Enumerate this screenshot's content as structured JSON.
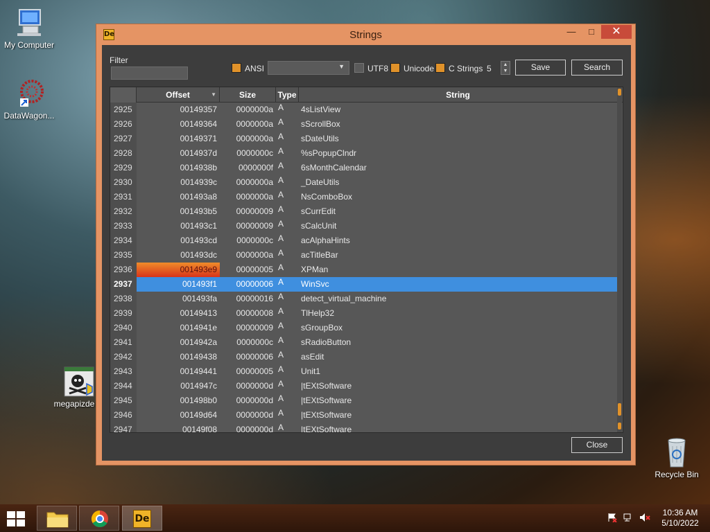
{
  "desktop": {
    "icons": [
      {
        "label": "My Computer"
      },
      {
        "label": "DataWagon..."
      },
      {
        "label": "megapizde"
      },
      {
        "label": "Recycle Bin"
      }
    ]
  },
  "window": {
    "title": "Strings",
    "minimize": "—",
    "maximize": "□",
    "close": "✕",
    "app_icon_text": "De"
  },
  "filter": {
    "label": "Filter",
    "value": ""
  },
  "options": {
    "ansi_label": "ANSI",
    "ansi_checked": true,
    "encoding_selected": "",
    "utf8_label": "UTF8",
    "utf8_checked": false,
    "unicode_label": "Unicode",
    "unicode_checked": true,
    "cstrings_label": "C Strings",
    "cstrings_checked": true,
    "min_length": "5"
  },
  "buttons": {
    "save": "Save",
    "search": "Search",
    "close": "Close"
  },
  "table": {
    "columns": {
      "offset": "Offset",
      "size": "Size",
      "type": "Type",
      "string": "String"
    },
    "rows": [
      {
        "idx": "2925",
        "offset": "00149357",
        "size": "0000000a",
        "type": "A",
        "string": "4sListView"
      },
      {
        "idx": "2926",
        "offset": "00149364",
        "size": "0000000a",
        "type": "A",
        "string": "sScrollBox"
      },
      {
        "idx": "2927",
        "offset": "00149371",
        "size": "0000000a",
        "type": "A",
        "string": "sDateUtils"
      },
      {
        "idx": "2928",
        "offset": "0014937d",
        "size": "0000000c",
        "type": "A",
        "string": "%sPopupClndr"
      },
      {
        "idx": "2929",
        "offset": "0014938b",
        "size": "0000000f",
        "type": "A",
        "string": "6sMonthCalendar"
      },
      {
        "idx": "2930",
        "offset": "0014939c",
        "size": "0000000a",
        "type": "A",
        "string": "_DateUtils"
      },
      {
        "idx": "2931",
        "offset": "001493a8",
        "size": "0000000a",
        "type": "A",
        "string": "NsComboBox"
      },
      {
        "idx": "2932",
        "offset": "001493b5",
        "size": "00000009",
        "type": "A",
        "string": "sCurrEdit"
      },
      {
        "idx": "2933",
        "offset": "001493c1",
        "size": "00000009",
        "type": "A",
        "string": "sCalcUnit"
      },
      {
        "idx": "2934",
        "offset": "001493cd",
        "size": "0000000c",
        "type": "A",
        "string": "acAlphaHints"
      },
      {
        "idx": "2935",
        "offset": "001493dc",
        "size": "0000000a",
        "type": "A",
        "string": "acTitleBar"
      },
      {
        "idx": "2936",
        "offset": "001493e9",
        "size": "00000005",
        "type": "A",
        "string": "XPMan"
      },
      {
        "idx": "2937",
        "offset": "001493f1",
        "size": "00000006",
        "type": "A",
        "string": "WinSvc"
      },
      {
        "idx": "2938",
        "offset": "001493fa",
        "size": "00000016",
        "type": "A",
        "string": "detect_virtual_machine"
      },
      {
        "idx": "2939",
        "offset": "00149413",
        "size": "00000008",
        "type": "A",
        "string": "TlHelp32"
      },
      {
        "idx": "2940",
        "offset": "0014941e",
        "size": "00000009",
        "type": "A",
        "string": "sGroupBox"
      },
      {
        "idx": "2941",
        "offset": "0014942a",
        "size": "0000000c",
        "type": "A",
        "string": "sRadioButton"
      },
      {
        "idx": "2942",
        "offset": "00149438",
        "size": "00000006",
        "type": "A",
        "string": "asEdit"
      },
      {
        "idx": "2943",
        "offset": "00149441",
        "size": "00000005",
        "type": "A",
        "string": "Unit1"
      },
      {
        "idx": "2944",
        "offset": "0014947c",
        "size": "0000000d",
        "type": "A",
        "string": "|tEXtSoftware"
      },
      {
        "idx": "2945",
        "offset": "001498b0",
        "size": "0000000d",
        "type": "A",
        "string": "|tEXtSoftware"
      },
      {
        "idx": "2946",
        "offset": "00149d64",
        "size": "0000000d",
        "type": "A",
        "string": "|tEXtSoftware"
      },
      {
        "idx": "2947",
        "offset": "00149f08",
        "size": "0000000d",
        "type": "A",
        "string": "|tEXtSoftware"
      }
    ],
    "selected_index": "2937",
    "highlighted_index": "2936"
  },
  "taskbar": {
    "clock_time": "10:36 AM",
    "clock_date": "5/10/2022",
    "app_button_text": "De"
  },
  "colors": {
    "accent": "#e0922a",
    "selection": "#3f8fdf",
    "frame": "#e59464"
  }
}
